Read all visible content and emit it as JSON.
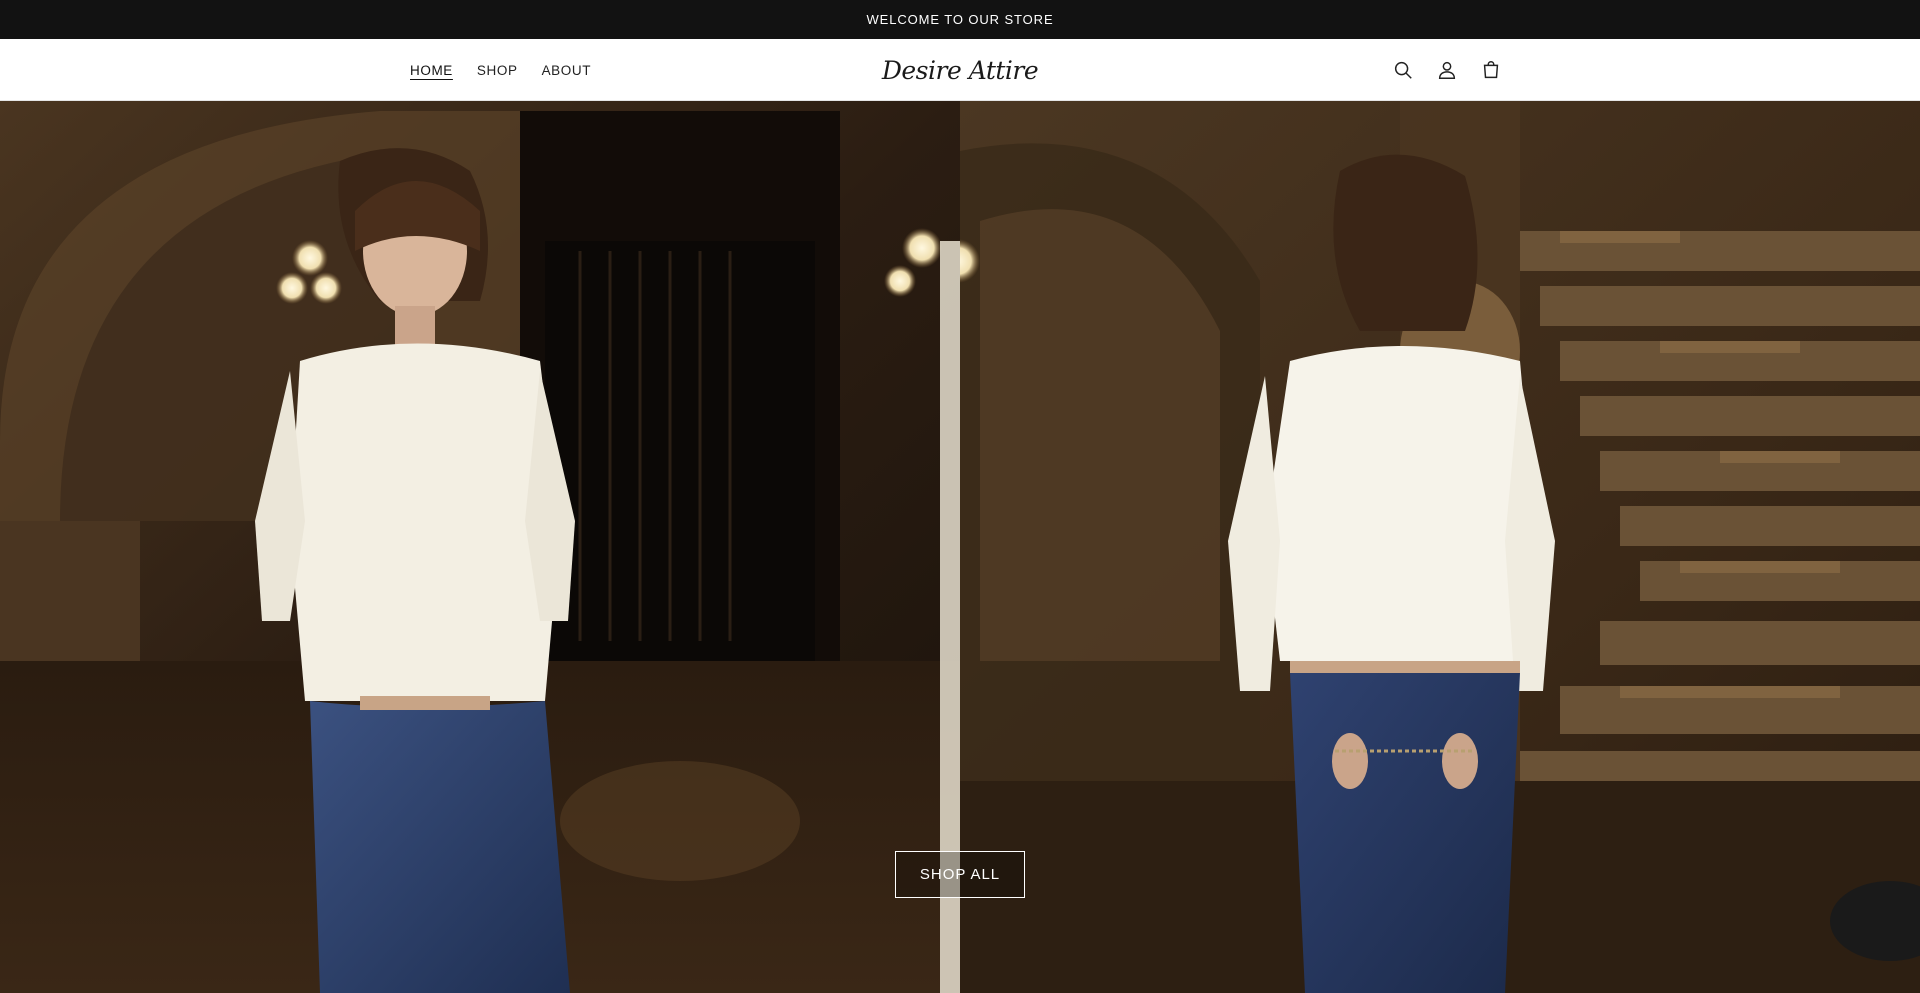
{
  "announcement": {
    "text": "WELCOME TO OUR STORE"
  },
  "nav": {
    "items": [
      {
        "label": "HOME",
        "active": true
      },
      {
        "label": "SHOP"
      },
      {
        "label": "ABOUT"
      }
    ]
  },
  "logo": {
    "text": "Desire Attire"
  },
  "header_icons": [
    "search-icon",
    "account-icon",
    "cart-icon"
  ],
  "hero": {
    "left_image": "model wearing white long-sleeve top and blue jeans, front view, in ornate hall",
    "right_image": "model wearing white long-sleeve top and blue jeans, back view, near staircase",
    "cta_label": "SHOP ALL"
  },
  "colors": {
    "announcement_bg": "#121212",
    "header_bg": "#ffffff",
    "text": "#111111"
  }
}
